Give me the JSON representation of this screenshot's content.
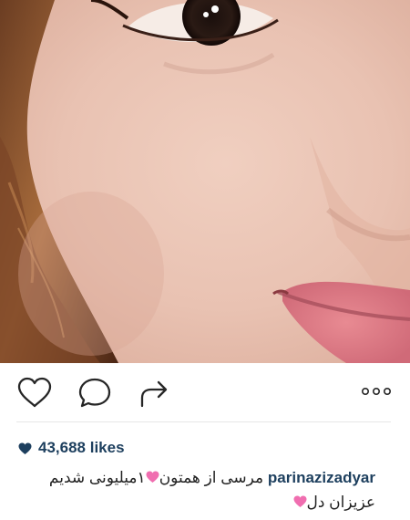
{
  "post": {
    "likes_count": "43,688 likes",
    "username": "parinazizadyar",
    "caption_line1_a": "۱میلیونی شدیم ",
    "caption_line1_b": "مرسی از همتون",
    "caption_line2": "عزیزان دل"
  },
  "icons": {
    "like": "heart-outline-icon",
    "comment": "speech-bubble-icon",
    "share": "share-arrow-icon",
    "more": "ellipsis-icon",
    "likes": "heart-filled-icon",
    "caption_emoji": "pink-heart-emoji"
  },
  "colors": {
    "username": "#1d3f5e",
    "icon_stroke": "#262626",
    "divider": "#e6e6e6",
    "emoji_heart": "#f06eb0"
  }
}
